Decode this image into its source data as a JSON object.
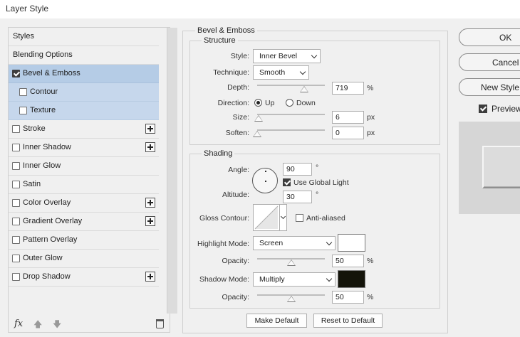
{
  "window": {
    "title": "Layer Style"
  },
  "styles_list": {
    "header": "Styles",
    "blending_options": "Blending Options",
    "items": [
      {
        "label": "Bevel & Emboss",
        "checked": true,
        "selected": true,
        "has_add": false
      },
      {
        "label": "Contour",
        "checked": false,
        "sub": true,
        "has_add": false
      },
      {
        "label": "Texture",
        "checked": false,
        "sub": true,
        "has_add": false
      },
      {
        "label": "Stroke",
        "checked": false,
        "has_add": true
      },
      {
        "label": "Inner Shadow",
        "checked": false,
        "has_add": true
      },
      {
        "label": "Inner Glow",
        "checked": false,
        "has_add": false
      },
      {
        "label": "Satin",
        "checked": false,
        "has_add": false
      },
      {
        "label": "Color Overlay",
        "checked": false,
        "has_add": true
      },
      {
        "label": "Gradient Overlay",
        "checked": false,
        "has_add": true
      },
      {
        "label": "Pattern Overlay",
        "checked": false,
        "has_add": false
      },
      {
        "label": "Outer Glow",
        "checked": false,
        "has_add": false
      },
      {
        "label": "Drop Shadow",
        "checked": false,
        "has_add": true
      }
    ],
    "fx_label": "fx"
  },
  "bevel": {
    "group_title": "Bevel & Emboss",
    "structure": {
      "title": "Structure",
      "style_label": "Style:",
      "style_value": "Inner Bevel",
      "technique_label": "Technique:",
      "technique_value": "Smooth",
      "depth_label": "Depth:",
      "depth_value": "719",
      "depth_unit": "%",
      "depth_slider_fraction": 0.69,
      "direction_label": "Direction:",
      "direction_up": "Up",
      "direction_down": "Down",
      "direction_selected": "Up",
      "size_label": "Size:",
      "size_value": "6",
      "size_unit": "px",
      "size_slider_fraction": 0.02,
      "soften_label": "Soften:",
      "soften_value": "0",
      "soften_unit": "px",
      "soften_slider_fraction": 0.0
    },
    "shading": {
      "title": "Shading",
      "angle_label": "Angle:",
      "angle_value": "90",
      "angle_unit": "°",
      "use_global_light": "Use Global Light",
      "use_global_light_checked": true,
      "altitude_label": "Altitude:",
      "altitude_value": "30",
      "altitude_unit": "°",
      "gloss_contour_label": "Gloss Contour:",
      "anti_aliased": "Anti-aliased",
      "anti_aliased_checked": false,
      "highlight_mode_label": "Highlight Mode:",
      "highlight_mode_value": "Screen",
      "highlight_color": "#ffffff",
      "highlight_opacity_label": "Opacity:",
      "highlight_opacity_value": "50",
      "highlight_opacity_unit": "%",
      "highlight_opacity_fraction": 0.5,
      "shadow_mode_label": "Shadow Mode:",
      "shadow_mode_value": "Multiply",
      "shadow_color": "#14140a",
      "shadow_opacity_label": "Opacity:",
      "shadow_opacity_value": "50",
      "shadow_opacity_unit": "%",
      "shadow_opacity_fraction": 0.5
    },
    "make_default": "Make Default",
    "reset_to_default": "Reset to Default"
  },
  "right_panel": {
    "ok": "OK",
    "cancel": "Cancel",
    "new_style": "New Style",
    "preview_label": "Preview",
    "preview_checked": true
  },
  "colors": {
    "selected_row": "#b5cce6",
    "sub_row": "#c6d7ec"
  }
}
